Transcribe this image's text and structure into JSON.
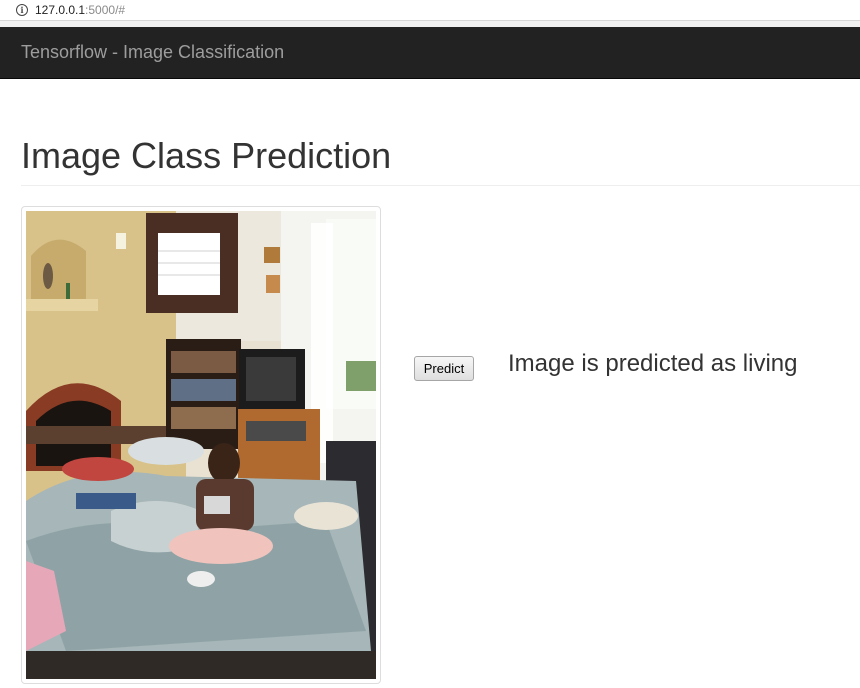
{
  "browser": {
    "address_host": "127.0.0.1",
    "address_rest": ":5000/#"
  },
  "navbar": {
    "brand": "Tensorflow - Image Classification"
  },
  "main": {
    "title": "Image Class Prediction",
    "predict_label": "Predict",
    "result_text": "Image is predicted as living"
  }
}
